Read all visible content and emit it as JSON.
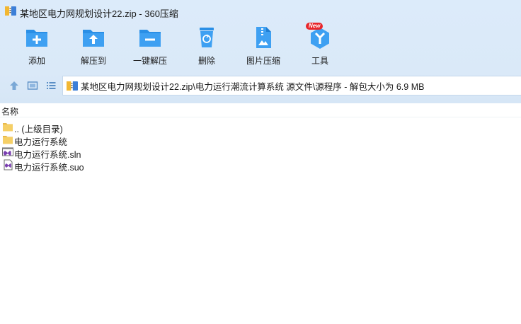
{
  "window": {
    "title": "某地区电力网规划设计22.zip - 360压缩"
  },
  "toolbar": {
    "items": [
      {
        "label": "添加",
        "icon": "add-icon"
      },
      {
        "label": "解压到",
        "icon": "extract-to-icon"
      },
      {
        "label": "一键解压",
        "icon": "one-click-extract-icon"
      },
      {
        "label": "删除",
        "icon": "delete-icon"
      },
      {
        "label": "图片压缩",
        "icon": "image-compress-icon"
      },
      {
        "label": "工具",
        "icon": "tools-icon",
        "badge": "New"
      }
    ]
  },
  "address": {
    "path": "某地区电力网规划设计22.zip\\电力运行潮流计算系统 源文件\\源程序 - 解包大小为 6.9 MB"
  },
  "list": {
    "column_name": "名称",
    "items": [
      {
        "name": ".. (上级目录)",
        "type": "folder"
      },
      {
        "name": "电力运行系统",
        "type": "folder"
      },
      {
        "name": "电力运行系统.sln",
        "type": "sln"
      },
      {
        "name": "电力运行系统.suo",
        "type": "suo"
      }
    ]
  },
  "colors": {
    "toolbar_bg": "#dae9f8",
    "icon_blue": "#2a8fe6",
    "folder_yellow": "#f5cf66",
    "badge_red": "#e8262b"
  }
}
